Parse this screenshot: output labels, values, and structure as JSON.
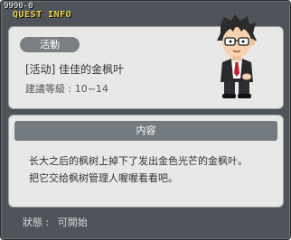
{
  "window": {
    "id": "9990-0",
    "title": "QUEST INFO"
  },
  "quest": {
    "tag": "活動",
    "name": "[活动] 佳佳的金枫叶",
    "level_label": "建議等級 :",
    "level_range": "10~14"
  },
  "description": {
    "header": "内容",
    "line1": "长大之后的枫树上掉下了发出金色光芒的金枫叶。",
    "line2": "把它交给枫树管理人喔喔看看吧。"
  },
  "status": {
    "label": "狀態 :",
    "value": "可開始"
  },
  "icons": {
    "npc": "npc-character-icon",
    "close": "close-icon"
  }
}
